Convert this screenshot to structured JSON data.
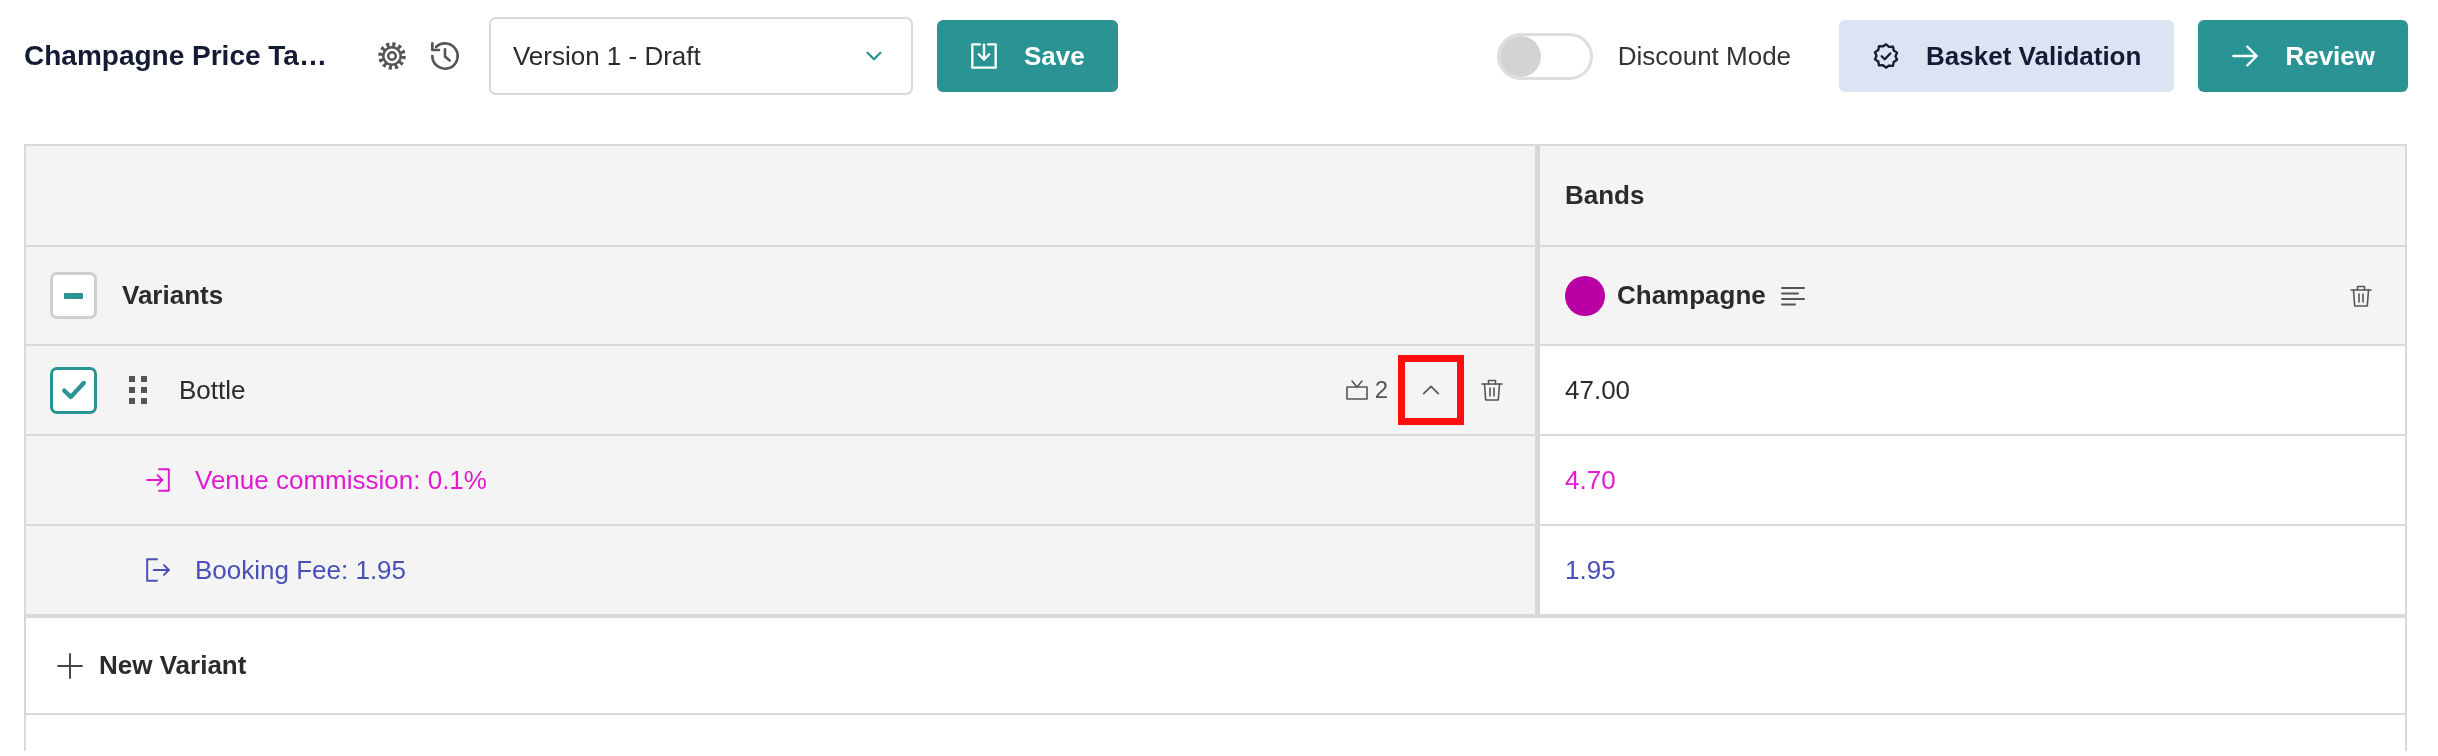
{
  "header": {
    "title": "Champagne Price Ta…",
    "version_select": {
      "value": "Version 1 - Draft"
    },
    "save_button": {
      "label": "Save"
    },
    "discount_mode": {
      "label": "Discount Mode",
      "on": false
    },
    "actions": [
      {
        "label": "Basket Validation",
        "kind": "secondary"
      },
      {
        "label": "Review",
        "kind": "primary"
      }
    ]
  },
  "table": {
    "bands_header": "Bands",
    "select_all": {
      "checked": false,
      "indeterminate": true
    },
    "variants_header": "Variants",
    "bands": [
      {
        "name": "Champagne",
        "color": "#b800a4"
      }
    ],
    "variants": [
      {
        "name": "Bottle",
        "checked": true,
        "modifier_count": "2",
        "expanded": true,
        "highlighted": true,
        "values": [
          "47.00"
        ],
        "modifiers": [
          {
            "kind": "commission",
            "label": "Venue commission: 0.1%",
            "color": "#e01ad0",
            "values": [
              "4.70"
            ]
          },
          {
            "kind": "fee",
            "label": "Booking Fee: 1.95",
            "color": "#4a50b8",
            "values": [
              "1.95"
            ]
          }
        ]
      }
    ],
    "new_variant": {
      "label": "New Variant"
    }
  }
}
